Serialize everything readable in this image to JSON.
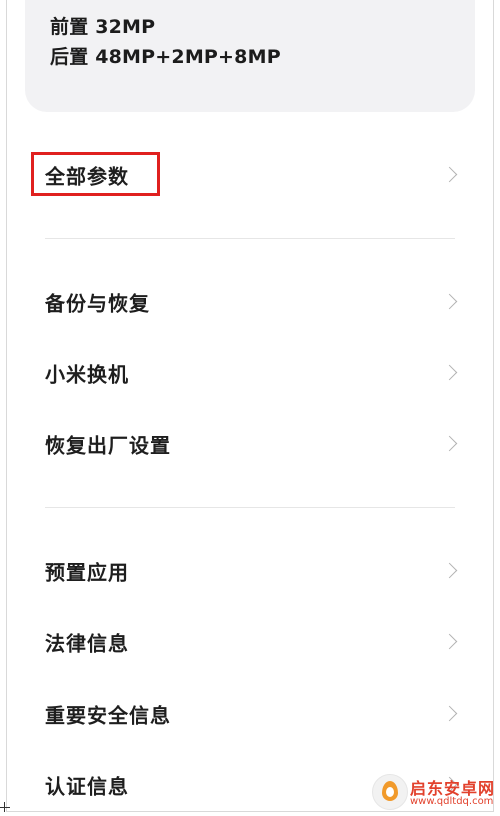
{
  "device_card": {
    "front_camera": "前置 32MP",
    "rear_camera": "后置 48MP+2MP+8MP"
  },
  "menu": {
    "all_params": "全部参数",
    "backup_restore": "备份与恢复",
    "mi_mover": "小米换机",
    "factory_reset": "恢复出厂设置",
    "preinstalled_apps": "预置应用",
    "legal_info": "法律信息",
    "safety_info": "重要安全信息",
    "certification": "认证信息"
  },
  "watermark": {
    "name": "启东安卓网",
    "url": "www.qdltdq.com"
  },
  "colors": {
    "highlight": "#e0201f",
    "watermark": "#e2412c"
  }
}
